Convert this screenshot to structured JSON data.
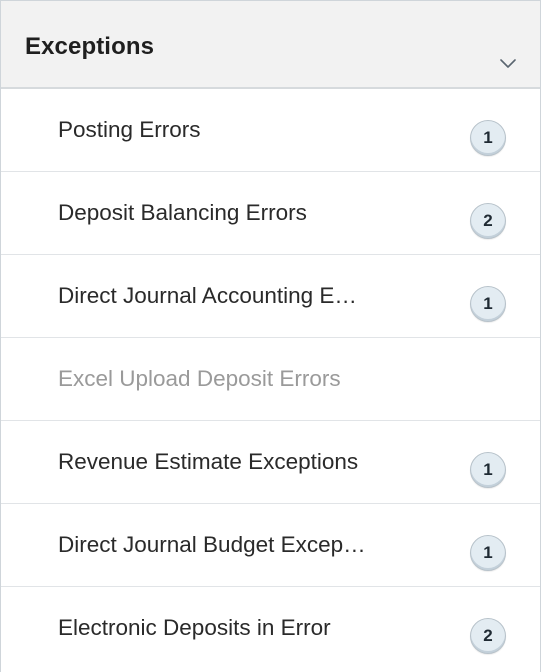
{
  "section": {
    "title": "Exceptions",
    "collapse_icon": "chevron-down-icon"
  },
  "items": [
    {
      "label": "Posting Errors",
      "count": "1",
      "enabled": true
    },
    {
      "label": "Deposit Balancing Errors",
      "count": "2",
      "enabled": true
    },
    {
      "label": "Direct Journal Accounting E…",
      "count": "1",
      "enabled": true
    },
    {
      "label": "Excel Upload Deposit Errors",
      "count": null,
      "enabled": false
    },
    {
      "label": "Revenue Estimate Exceptions",
      "count": "1",
      "enabled": true
    },
    {
      "label": "Direct Journal Budget Excep…",
      "count": "1",
      "enabled": true
    },
    {
      "label": "Electronic Deposits in Error",
      "count": "2",
      "enabled": true
    }
  ],
  "colors": {
    "header_bg": "#f2f2f2",
    "badge_bg": "#e3ecf2",
    "disabled_text": "#9a9a9a"
  }
}
